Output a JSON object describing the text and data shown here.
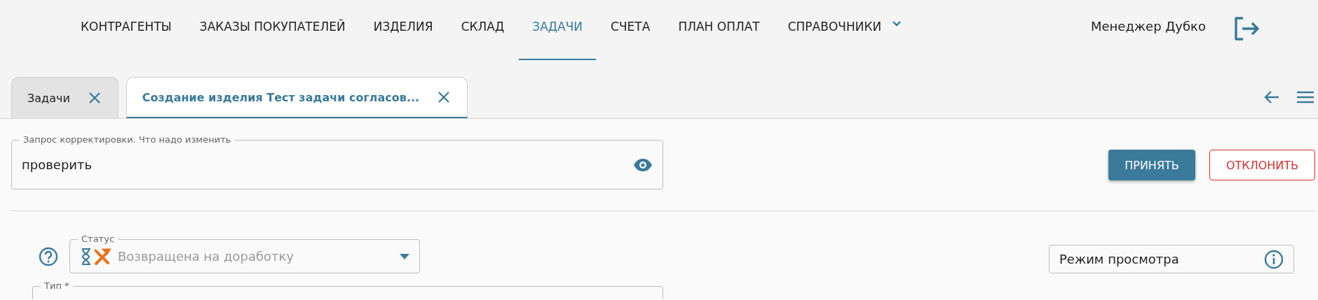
{
  "nav": {
    "items": [
      {
        "label": "КОНТРАГЕНТЫ",
        "selected": false,
        "kind": "link"
      },
      {
        "label": "ЗАКАЗЫ ПОКУПАТЕЛЕЙ",
        "selected": false,
        "kind": "link"
      },
      {
        "label": "ИЗДЕЛИЯ",
        "selected": false,
        "kind": "link"
      },
      {
        "label": "СКЛАД",
        "selected": false,
        "kind": "link"
      },
      {
        "label": "ЗАДАЧИ",
        "selected": true,
        "kind": "link"
      },
      {
        "label": "СЧЕТА",
        "selected": false,
        "kind": "link"
      },
      {
        "label": "ПЛАН ОПЛАТ",
        "selected": false,
        "kind": "link"
      },
      {
        "label": "СПРАВОЧНИКИ",
        "selected": false,
        "kind": "dropdown"
      }
    ],
    "user": "Менеджер Дубко"
  },
  "tabs": [
    {
      "label": "Задачи",
      "selected": false
    },
    {
      "label": "Создание изделия Тест задачи согласов...",
      "selected": true
    }
  ],
  "correction_field": {
    "label": "Запрос корректировки. Что надо изменить",
    "value": "проверить"
  },
  "buttons": [
    {
      "label": "ПРИНЯТЬ",
      "kind": "primary"
    },
    {
      "label": "ОТКЛОНИТЬ",
      "kind": "danger"
    }
  ],
  "status_field": {
    "label": "Статус",
    "value": "Возвращена на доработку",
    "disabled": true
  },
  "mode_field": {
    "value": "Режим просмотра"
  },
  "type_field": {
    "label": "Тип *"
  }
}
